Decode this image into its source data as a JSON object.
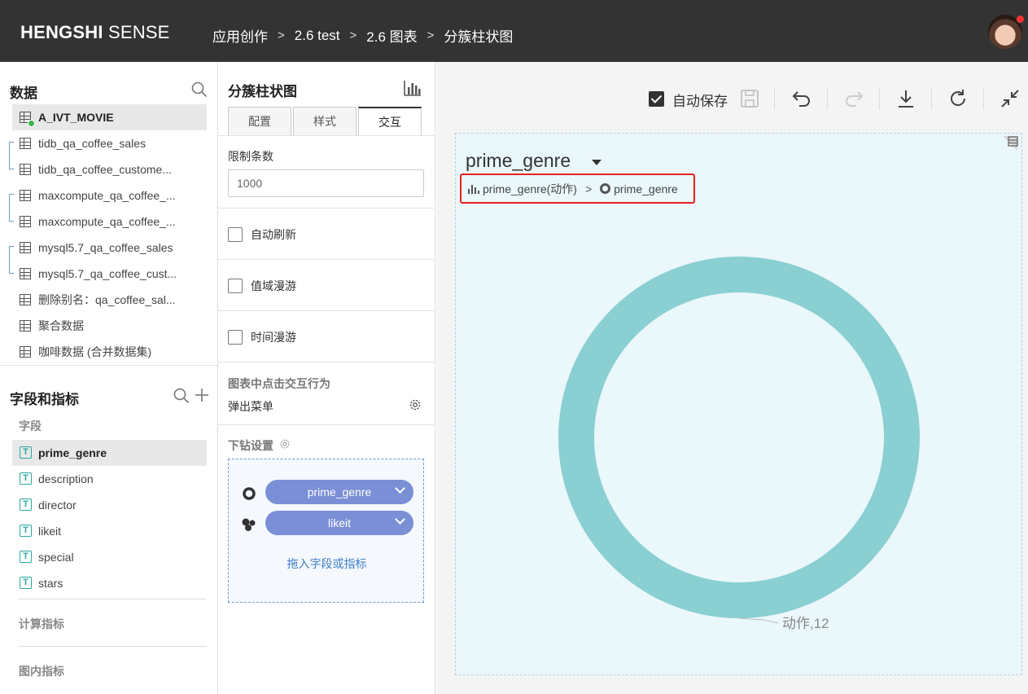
{
  "header": {
    "brand_bold": "HENGSHI",
    "brand_light": " SENSE",
    "breadcrumbs": [
      "应用创作",
      "2.6 test",
      "2.6 图表",
      "分簇柱状图"
    ],
    "breadcrumb_sep": ">"
  },
  "left": {
    "data_title": "数据",
    "datasets": [
      "A_IVT_MOVIE",
      "tidb_qa_coffee_sales",
      "tidb_qa_coffee_custome...",
      "maxcompute_qa_coffee_...",
      "maxcompute_qa_coffee_...",
      "mysql5.7_qa_coffee_sales",
      "mysql5.7_qa_coffee_cust...",
      "删除别名：qa_coffee_sal...",
      "聚合数据",
      "咖啡数据 (合并数据集)"
    ],
    "fields_title": "字段和指标",
    "fields_label": "字段",
    "fields": [
      "prime_genre",
      "description",
      "director",
      "likeit",
      "special",
      "stars"
    ],
    "field_type_glyph": "T",
    "calc_label": "计算指标",
    "inchart_label": "图内指标"
  },
  "middle": {
    "title": "分簇柱状图",
    "tabs": [
      "配置",
      "样式",
      "交互"
    ],
    "limit_label": "限制条数",
    "limit_value": "1000",
    "auto_refresh": "自动刷新",
    "range_roam": "值域漫游",
    "time_roam": "时间漫游",
    "click_behavior_label": "图表中点击交互行为",
    "click_behavior_value": "弹出菜单",
    "drill_label": "下钻设置",
    "drill_fields": [
      "prime_genre",
      "likeit"
    ],
    "drop_hint": "拖入字段或指标"
  },
  "toolbar": {
    "autosave_label": "自动保存",
    "autosave_checked": true
  },
  "chart": {
    "title": "prime_genre",
    "drill_path": [
      "prime_genre(动作)",
      "prime_genre"
    ],
    "ring_color": "#8acfd1"
  },
  "chart_data": {
    "type": "pie",
    "variant": "donut",
    "categories": [
      "动作"
    ],
    "values": [
      12
    ],
    "labels": [
      "动作,12"
    ],
    "title": "prime_genre",
    "legend": "none"
  }
}
